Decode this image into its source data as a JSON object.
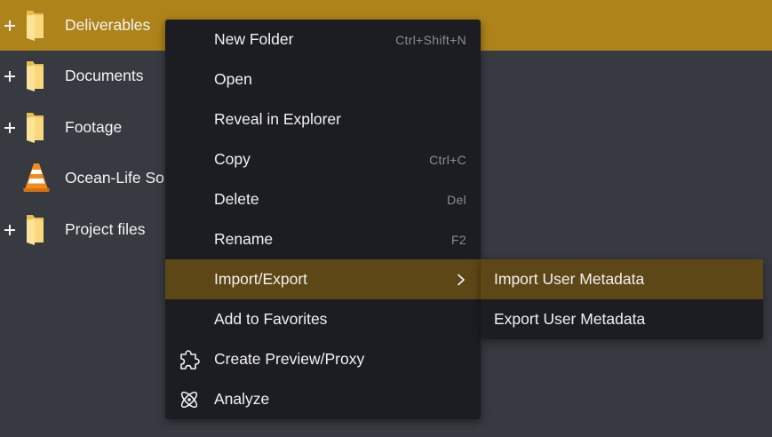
{
  "tree": {
    "items": [
      {
        "label": "Deliverables",
        "icon": "folder-icon",
        "expandable": true,
        "selected": true
      },
      {
        "label": "Documents",
        "icon": "folder-icon",
        "expandable": true,
        "selected": false
      },
      {
        "label": "Footage",
        "icon": "folder-icon",
        "expandable": true,
        "selected": false
      },
      {
        "label": "Ocean-Life Sou",
        "icon": "vlc-cone-icon",
        "expandable": false,
        "selected": false
      },
      {
        "label": "Project files",
        "icon": "folder-icon",
        "expandable": true,
        "selected": false
      }
    ]
  },
  "context_menu": {
    "items": [
      {
        "label": "New Folder",
        "shortcut": "Ctrl+Shift+N"
      },
      {
        "label": "Open",
        "shortcut": ""
      },
      {
        "label": "Reveal in Explorer",
        "shortcut": ""
      },
      {
        "label": "Copy",
        "shortcut": "Ctrl+C"
      },
      {
        "label": "Delete",
        "shortcut": "Del"
      },
      {
        "label": "Rename",
        "shortcut": "F2"
      },
      {
        "label": "Import/Export",
        "shortcut": "",
        "submenu": true,
        "active": true
      },
      {
        "label": "Add to Favorites",
        "shortcut": ""
      },
      {
        "label": "Create Preview/Proxy",
        "shortcut": "",
        "icon": "puzzle-piece-icon"
      },
      {
        "label": "Analyze",
        "shortcut": "",
        "icon": "atom-icon"
      }
    ]
  },
  "submenu": {
    "items": [
      {
        "label": "Import User Metadata",
        "active": true
      },
      {
        "label": "Export User Metadata",
        "active": false
      }
    ]
  },
  "colors": {
    "background": "#383a42",
    "selection": "#ae841a",
    "menu_bg": "#1c1d22",
    "menu_active": "#5d4716",
    "folder": "#f5cf6e",
    "cone": "#f08b1c"
  }
}
